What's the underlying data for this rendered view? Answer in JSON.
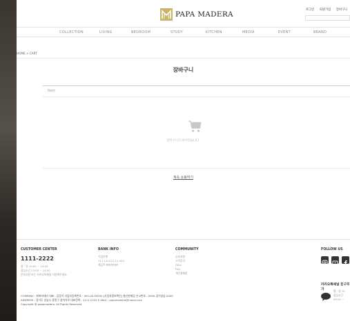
{
  "header": {
    "util_links": [
      "로그인",
      "회원가입",
      "장바구니"
    ],
    "logo_text": "PAPA MADERA"
  },
  "nav": {
    "items": [
      "COLLECTION",
      "LIVING",
      "BEDROOM",
      "STUDY",
      "KITCHEN",
      "MEDIA",
      "EVENT",
      "BRAND"
    ]
  },
  "breadcrumb": "HOME > CART",
  "cart": {
    "title": "장바구니",
    "item_header": "Item",
    "empty_message": "장바구니가 비어있습니다.",
    "continue_link": "계속 쇼핑하기"
  },
  "footer": {
    "customer_center": {
      "heading": "CUSTOMER CENTER",
      "phone": "1111-2222",
      "lines": [
        "평 · 일 10:00 ~ 19:00",
        "점심시간 13:00 ~ 14:00",
        "문의사항 또는 카카오톡채널 이용해주세요."
      ]
    },
    "bank_info": {
      "heading": "BANK INFO",
      "lines": [
        "기업은행",
        "111-111111-11-444",
        "예금주:파파마데라"
      ]
    },
    "community": {
      "heading": "COMMUNITY",
      "lines": [
        "공지사항",
        "고객후기",
        "Q&A",
        "FAQ",
        "개인결제창"
      ]
    },
    "follow": {
      "heading": "FOLLOW US"
    },
    "kakao": {
      "heading": "카카오톡채널 친구추가",
      "lines": [
        "평 · 일 10",
        "점심시간",
        "09:00 ~"
      ]
    },
    "company_info": [
      "COMPANY : 파파마데라   대표 : 김정기   사업자등록번호 : 000-00-00000 [사업자정보확인]   통신판매업 신고번호 : 0000-경기성남-0000",
      "ADDRESS : 경기도 성남시 중원구 갈마치로   대표전화 : 1111-2222   E-MAIL : papamadera@naver.com",
      "Copyright @ papamadera. All Rights Reserved."
    ]
  }
}
